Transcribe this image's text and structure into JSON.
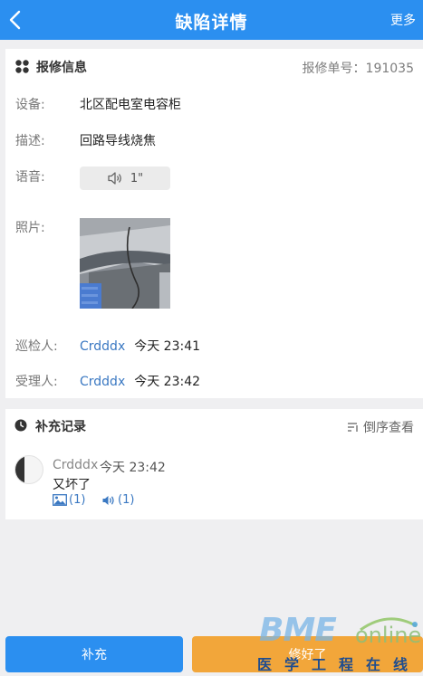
{
  "header": {
    "title": "缺陷详情",
    "more_label": "更多"
  },
  "report": {
    "section_title": "报修信息",
    "order_label": "报修单号：",
    "order_no": "191035",
    "fields": {
      "device_label": "设备:",
      "device_value": "北区配电室电容柜",
      "desc_label": "描述:",
      "desc_value": "回路导线烧焦",
      "voice_label": "语音:",
      "voice_duration": "1\"",
      "photo_label": "照片:",
      "inspector_label": "巡检人:",
      "inspector_name": "Crdddx",
      "inspector_time": "今天 23:41",
      "handler_label": "受理人:",
      "handler_name": "Crdddx",
      "handler_time": "今天 23:42"
    }
  },
  "records": {
    "section_title": "补充记录",
    "sort_label": "倒序查看",
    "items": [
      {
        "name": "Crdddx",
        "time": "今天 23:42",
        "content": "又坏了",
        "image_count": "(1)",
        "audio_count": "(1)"
      }
    ]
  },
  "bottom": {
    "supplement_label": "补充",
    "repaired_label": "修好了"
  },
  "watermark": {
    "brand_bme": "BME",
    "brand_online": "online",
    "brand_cn": "医学工程在线"
  },
  "colors": {
    "primary": "#2b8ff0",
    "accent_orange": "#f2a63a",
    "link_blue": "#3a78c2"
  }
}
